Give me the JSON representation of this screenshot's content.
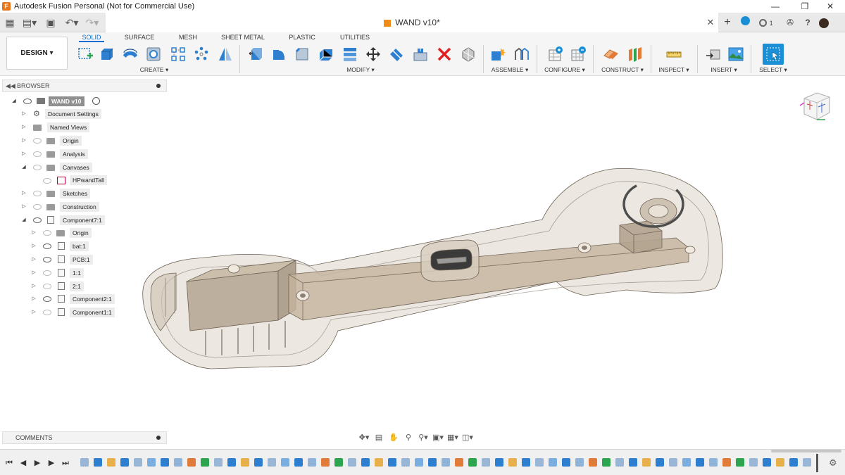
{
  "window": {
    "title": "Autodesk Fusion Personal (Not for Commercial Use)",
    "app_icon": "F"
  },
  "tabbar": {
    "document_tab": "WAND v10*",
    "job_count": "1"
  },
  "toolbar": {
    "workspace": "DESIGN",
    "workspace_tabs": [
      "SOLID",
      "SURFACE",
      "MESH",
      "SHEET METAL",
      "PLASTIC",
      "UTILITIES"
    ],
    "active_tab": "SOLID",
    "groups": {
      "create": "CREATE",
      "modify": "MODIFY",
      "assemble": "ASSEMBLE",
      "configure": "CONFIGURE",
      "construct": "CONSTRUCT",
      "inspect": "INSPECT",
      "insert": "INSERT",
      "select": "SELECT"
    }
  },
  "browser": {
    "title": "BROWSER",
    "root": "WAND v10",
    "items": [
      {
        "label": "Document Settings"
      },
      {
        "label": "Named Views"
      },
      {
        "label": "Origin"
      },
      {
        "label": "Analysis"
      },
      {
        "label": "Canvases"
      },
      {
        "label": "HPwandTall"
      },
      {
        "label": "Sketches"
      },
      {
        "label": "Construction"
      },
      {
        "label": "Component7:1"
      },
      {
        "label": "Origin"
      },
      {
        "label": "bat:1"
      },
      {
        "label": "PCB:1"
      },
      {
        "label": "1:1"
      },
      {
        "label": "2:1"
      },
      {
        "label": "Component2:1"
      },
      {
        "label": "Component1:1"
      }
    ]
  },
  "comments": {
    "title": "COMMENTS"
  },
  "colors": {
    "accent": "#0a6ed1",
    "orange": "#f28b1a",
    "model_fill": "#cdbfae",
    "model_stroke": "#7a6a58"
  }
}
